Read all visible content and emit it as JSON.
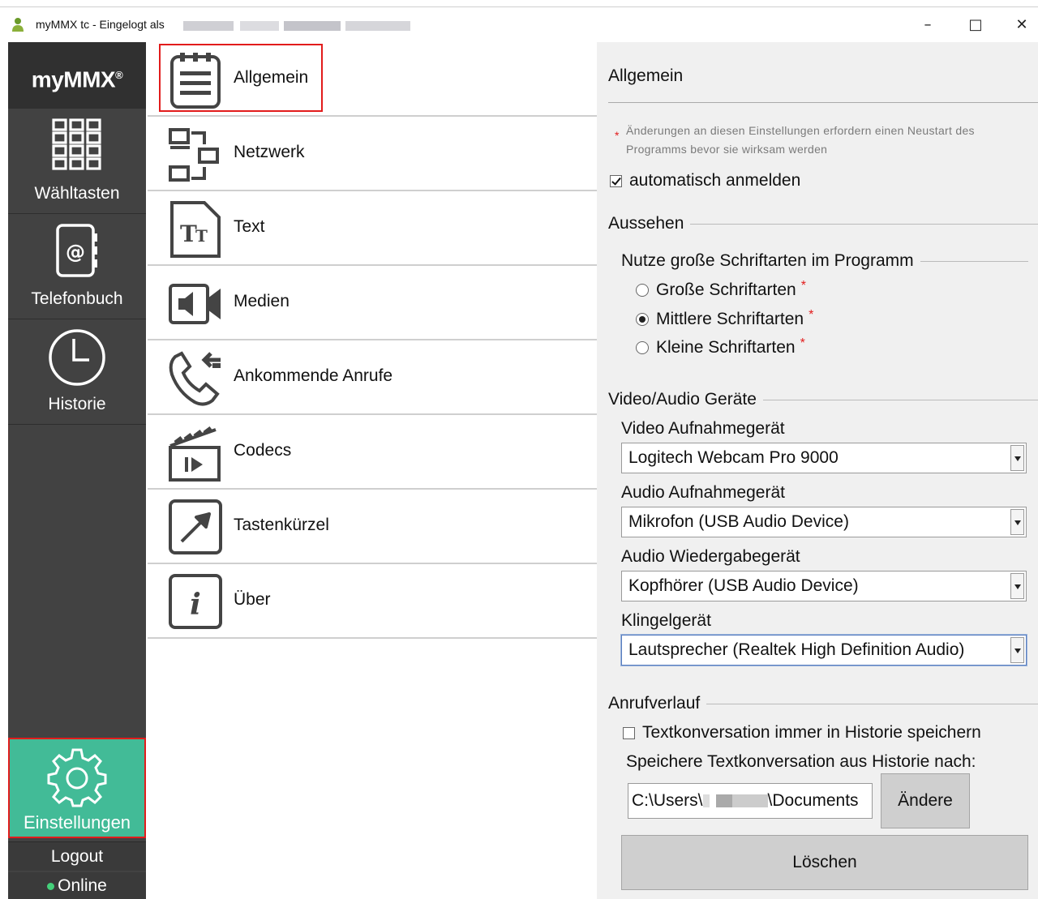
{
  "window": {
    "title": "myMMX tc - Eingelogt als",
    "minimize": "–",
    "maximize": "□",
    "close": "✕"
  },
  "sidebar": {
    "logo": "myMMX",
    "logo_mark": "®",
    "items": [
      {
        "label": "Wähltasten",
        "icon": "dialpad-icon"
      },
      {
        "label": "Telefonbuch",
        "icon": "phonebook-icon"
      },
      {
        "label": "Historie",
        "icon": "clock-icon"
      }
    ],
    "settings": {
      "label": "Einstellungen",
      "icon": "gear-icon"
    },
    "logout": "Logout",
    "status": "Online",
    "status_color": "#44d07a"
  },
  "menu": {
    "items": [
      {
        "label": "Allgemein",
        "icon": "notepad-icon",
        "active": true
      },
      {
        "label": "Netzwerk",
        "icon": "network-icon"
      },
      {
        "label": "Text",
        "icon": "text-icon"
      },
      {
        "label": "Medien",
        "icon": "media-icon"
      },
      {
        "label": "Ankommende Anrufe",
        "icon": "incoming-call-icon"
      },
      {
        "label": "Codecs",
        "icon": "clapperboard-icon"
      },
      {
        "label": "Tastenkürzel",
        "icon": "shortcut-icon"
      },
      {
        "label": "Über",
        "icon": "info-icon"
      }
    ]
  },
  "panel": {
    "title": "Allgemein",
    "note": "Änderungen an diesen Einstellungen erfordern einen Neustart des Programms bevor sie wirksam werden",
    "note_star": "*",
    "auto_login": {
      "label": "automatisch anmelden",
      "checked": true
    },
    "appearance": {
      "section": "Aussehen",
      "font_group": "Nutze große Schriftarten im Programm",
      "options": [
        {
          "label": "Große Schriftarten",
          "selected": false
        },
        {
          "label": "Mittlere Schriftarten",
          "selected": true
        },
        {
          "label": "Kleine Schriftarten",
          "selected": false
        }
      ],
      "req": "*"
    },
    "devices": {
      "section": "Video/Audio Geräte",
      "video_label": "Video Aufnahmegerät",
      "video_value": "Logitech Webcam Pro 9000",
      "audio_in_label": "Audio Aufnahmegerät",
      "audio_in_value": "Mikrofon (USB Audio Device)",
      "audio_out_label": "Audio Wiedergabegerät",
      "audio_out_value": "Kopfhörer (USB Audio Device)",
      "ring_label": "Klingelgerät",
      "ring_value": "Lautsprecher (Realtek High Definition Audio)"
    },
    "history": {
      "section": "Anrufverlauf",
      "save_text_label": "Textkonversation immer in Historie speichern",
      "save_text_checked": false,
      "save_path_label": "Speichere Textkonversation aus Historie nach:",
      "path_prefix": "C:\\Users\\",
      "path_suffix": "\\Documents",
      "change_button": "Ändere",
      "delete_button": "Löschen"
    }
  },
  "colors": {
    "sidebar_bg": "#424242",
    "accent_green": "#42bb97",
    "highlight_red": "#e21c1c"
  }
}
